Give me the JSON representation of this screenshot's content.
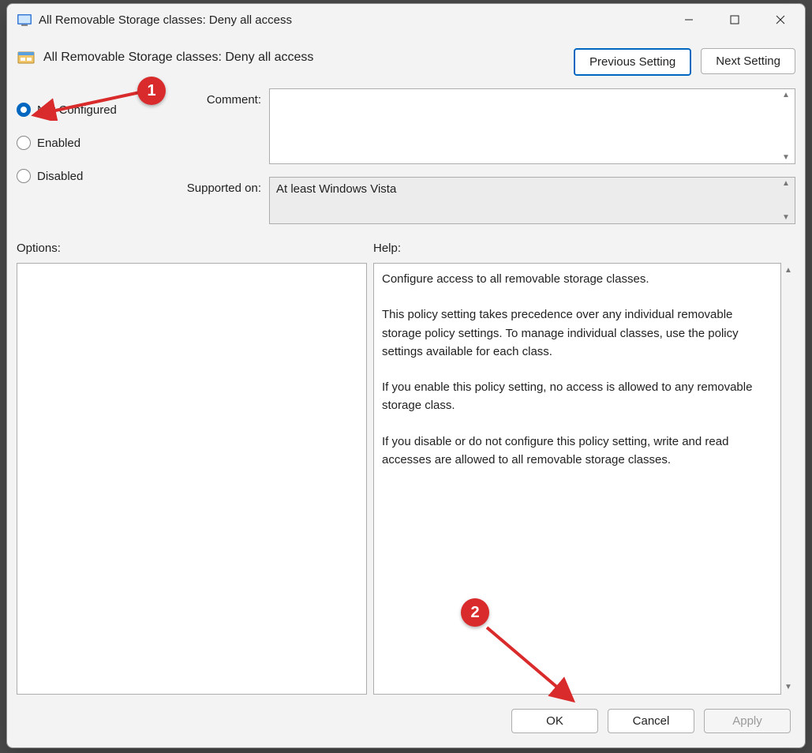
{
  "window": {
    "title": "All Removable Storage classes: Deny all access"
  },
  "header": {
    "policy_title": "All Removable Storage classes: Deny all access",
    "prev_btn": "Previous Setting",
    "next_btn": "Next Setting"
  },
  "radios": {
    "not_configured": "Not Configured",
    "enabled": "Enabled",
    "disabled": "Disabled"
  },
  "fields": {
    "comment_label": "Comment:",
    "comment_value": "",
    "supported_label": "Supported on:",
    "supported_value": "At least Windows Vista"
  },
  "sections": {
    "options_label": "Options:",
    "help_label": "Help:"
  },
  "help": {
    "p1": "Configure access to all removable storage classes.",
    "p2": "This policy setting takes precedence over any individual removable storage policy settings. To manage individual classes, use the policy settings available for each class.",
    "p3": "If you enable this policy setting, no access is allowed to any removable storage class.",
    "p4": "If you disable or do not configure this policy setting, write and read accesses are allowed to all removable storage classes."
  },
  "footer": {
    "ok": "OK",
    "cancel": "Cancel",
    "apply": "Apply"
  },
  "annotations": {
    "badge1": "1",
    "badge2": "2"
  }
}
